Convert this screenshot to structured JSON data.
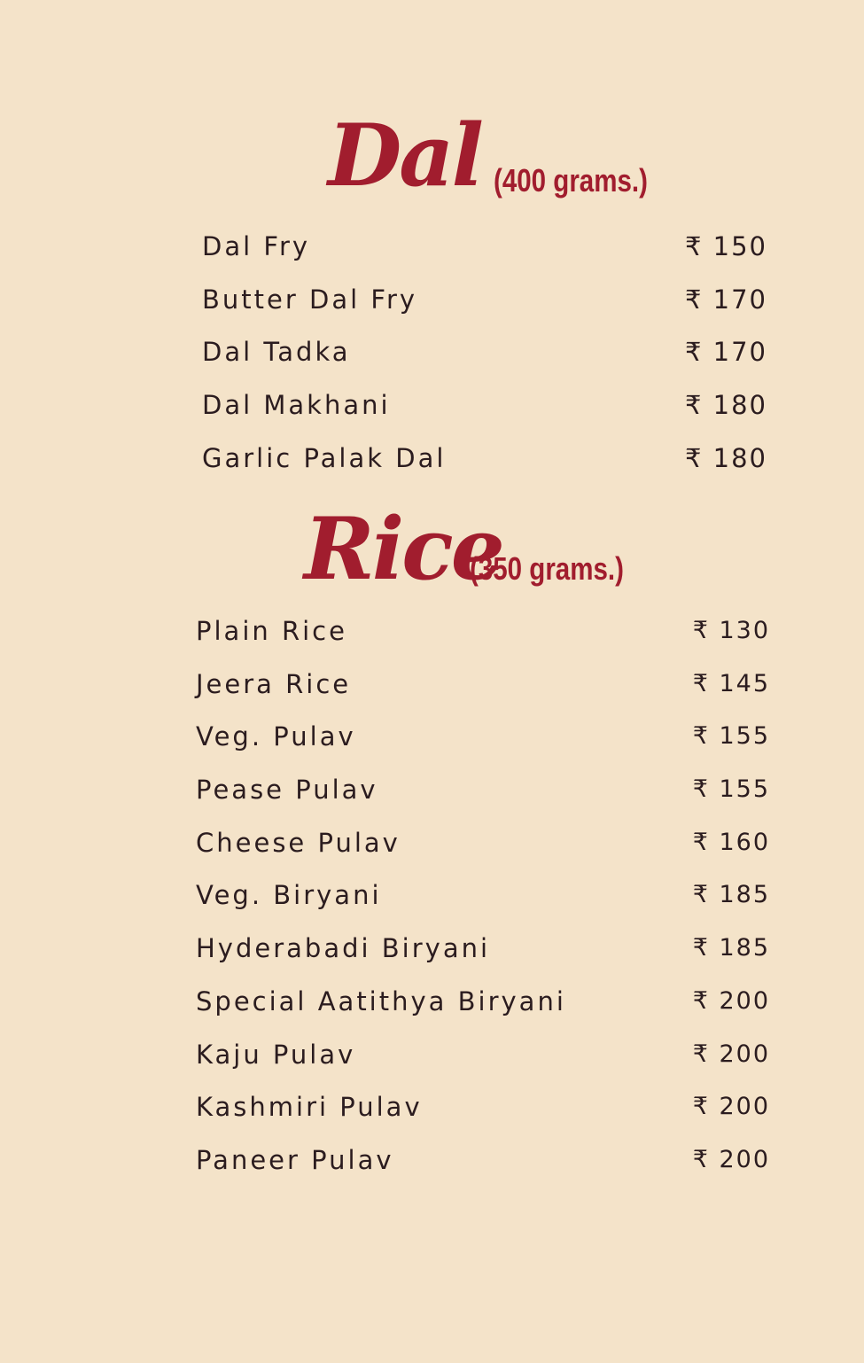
{
  "currency_symbol": "₹",
  "dal": {
    "title": "Dal",
    "weight": "(400 grams.)",
    "items": [
      {
        "name": "Dal Fry",
        "price": "₹ 150"
      },
      {
        "name": "Butter Dal Fry",
        "price": "₹ 170"
      },
      {
        "name": "Dal Tadka",
        "price": "₹ 170"
      },
      {
        "name": "Dal Makhani",
        "price": "₹ 180"
      },
      {
        "name": "Garlic Palak Dal",
        "price": "₹ 180"
      }
    ]
  },
  "rice": {
    "title": "Rice",
    "weight": "(350 grams.)",
    "items": [
      {
        "name": "Plain Rice",
        "price": "₹ 130"
      },
      {
        "name": "Jeera Rice",
        "price": "₹ 145"
      },
      {
        "name": "Veg. Pulav",
        "price": "₹ 155"
      },
      {
        "name": "Pease Pulav",
        "price": "₹ 155"
      },
      {
        "name": "Cheese Pulav",
        "price": "₹ 160"
      },
      {
        "name": "Veg. Biryani",
        "price": "₹ 185"
      },
      {
        "name": "Hyderabadi Biryani",
        "price": "₹ 185"
      },
      {
        "name": "Special Aatithya Biryani",
        "price": "₹ 200"
      },
      {
        "name": "Kaju Pulav",
        "price": "₹ 200"
      },
      {
        "name": "Kashmiri Pulav",
        "price": "₹ 200"
      },
      {
        "name": "Paneer Pulav",
        "price": "₹ 200"
      }
    ]
  },
  "colors": {
    "background": "#f4e3c9",
    "heading": "#a11d2e",
    "text": "#2b1c1f"
  }
}
